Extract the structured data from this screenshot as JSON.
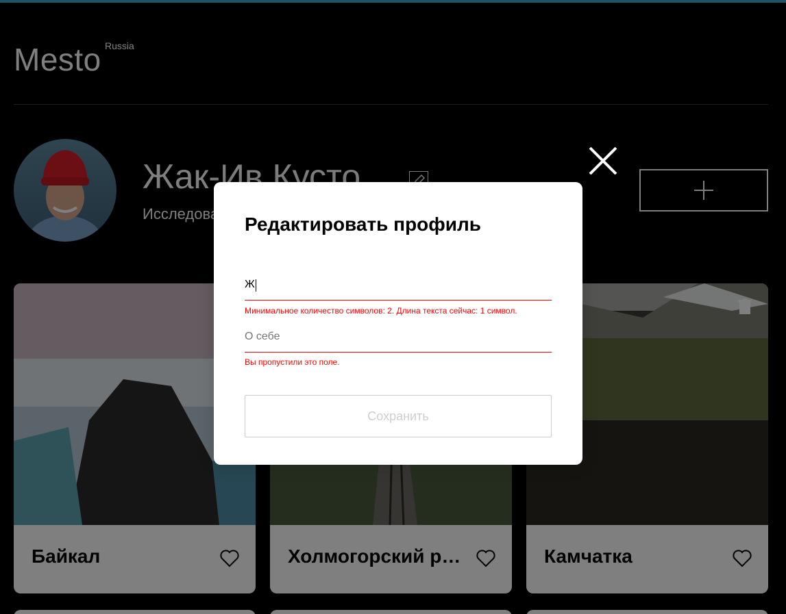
{
  "header": {
    "logo_text": "Mesto",
    "logo_sup": "Russia"
  },
  "profile": {
    "name": "Жак-Ив Кусто",
    "about": "Исследователь океана"
  },
  "cards": [
    {
      "title": "Байкал",
      "like_icon": "heart-outline-icon"
    },
    {
      "title": "Холмогорский район",
      "like_icon": "heart-outline-icon"
    },
    {
      "title": "Камчатка",
      "like_icon": "heart-outline-icon",
      "delete_icon": "trash-icon"
    }
  ],
  "modal": {
    "title": "Редактировать профиль",
    "name_value": "Ж",
    "name_error": "Минимальное количество символов: 2. Длина текста сейчас: 1 символ.",
    "about_value": "",
    "about_placeholder": "О себе",
    "about_error": "Вы пропустили это поле.",
    "save_label": "Сохранить",
    "close_icon": "close-icon"
  },
  "colors": {
    "accent_topbar": "#3fa9c9",
    "error": "#ff0000",
    "background": "#000000"
  }
}
